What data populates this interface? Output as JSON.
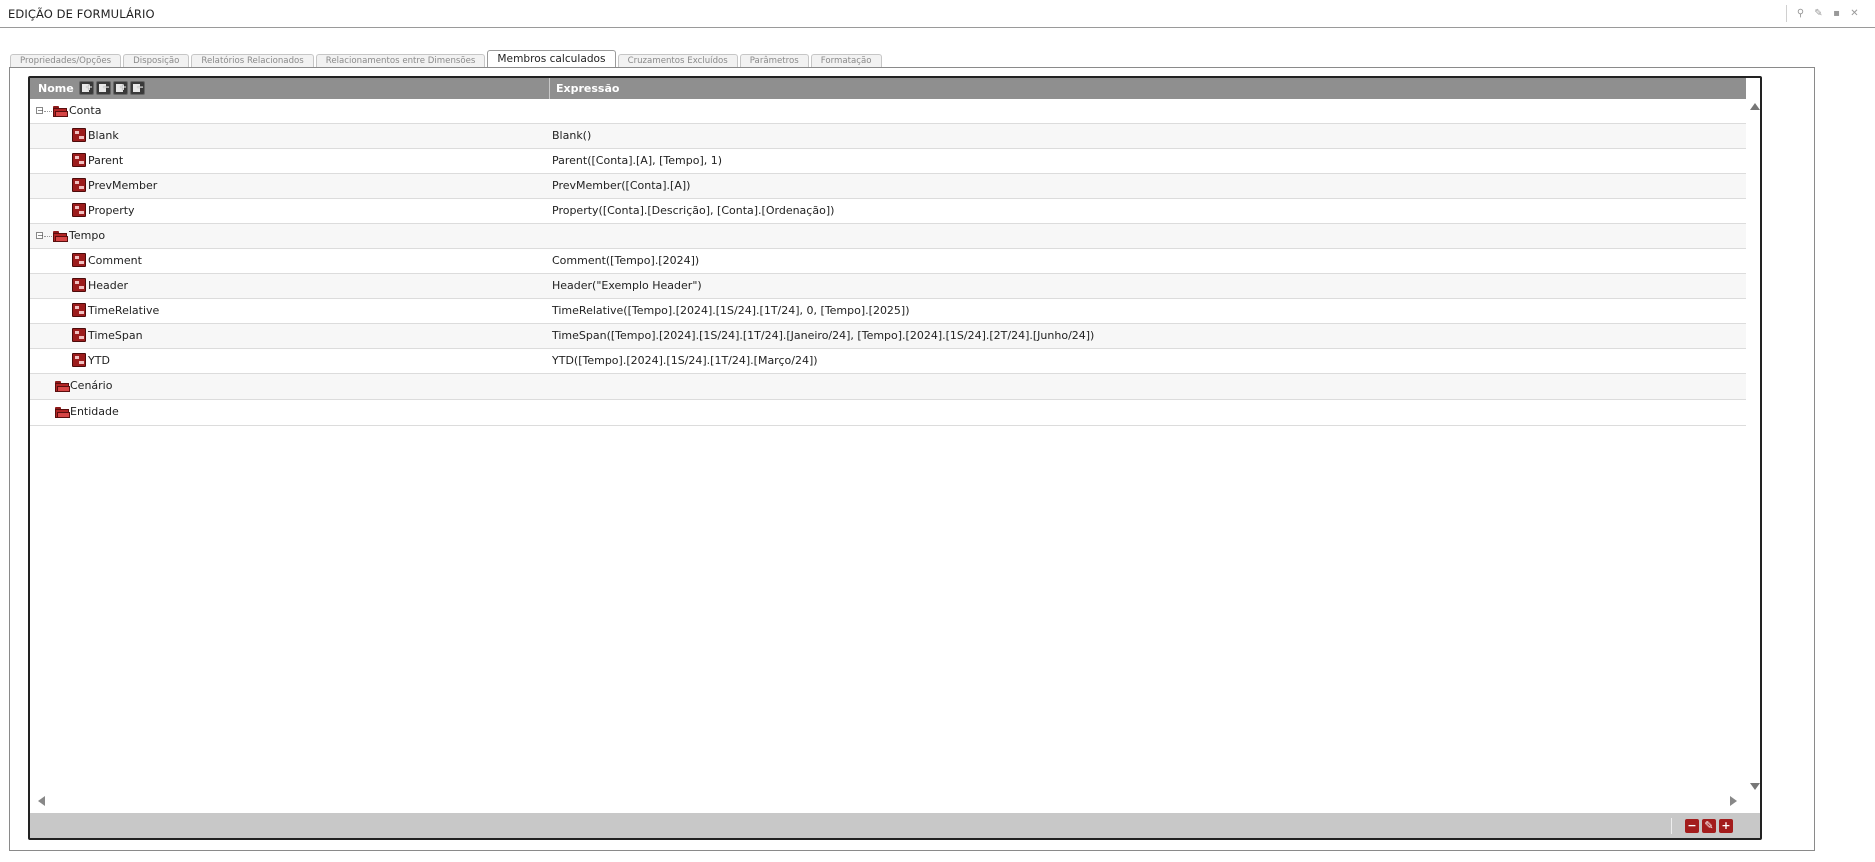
{
  "window": {
    "title": "EDIÇÃO DE FORMULÁRIO",
    "controls": [
      {
        "icon": "search-icon",
        "glyph": "⚲"
      },
      {
        "icon": "edit-icon",
        "glyph": "✎"
      },
      {
        "icon": "save-icon",
        "glyph": "▪"
      },
      {
        "icon": "close-icon",
        "glyph": "✕"
      }
    ]
  },
  "tabs": [
    {
      "label": "Propriedades/Opções",
      "active": false
    },
    {
      "label": "Disposição",
      "active": false
    },
    {
      "label": "Relatórios Relacionados",
      "active": false
    },
    {
      "label": "Relacionamentos entre Dimensões",
      "active": false
    },
    {
      "label": "Membros calculados",
      "active": true
    },
    {
      "label": "Cruzamentos Excluídos",
      "active": false
    },
    {
      "label": "Parâmetros",
      "active": false
    },
    {
      "label": "Formatação",
      "active": false
    }
  ],
  "grid": {
    "columns": {
      "name": "Nome",
      "expression": "Expressão"
    },
    "header_buttons": [
      {
        "icon": "add-icon",
        "badge": "+"
      },
      {
        "icon": "remove-icon",
        "badge": "−"
      },
      {
        "icon": "expand-icon",
        "badge": "+"
      },
      {
        "icon": "collapse-icon",
        "badge": "−"
      }
    ],
    "rows": [
      {
        "type": "group",
        "name": "Conta",
        "expanded": true,
        "expander": "−"
      },
      {
        "type": "member",
        "name": "Blank",
        "expression": "Blank()"
      },
      {
        "type": "member",
        "name": "Parent",
        "expression": "Parent([Conta].[A], [Tempo], 1)"
      },
      {
        "type": "member",
        "name": "PrevMember",
        "expression": "PrevMember([Conta].[A])"
      },
      {
        "type": "member",
        "name": "Property",
        "expression": "Property([Conta].[Descrição], [Conta].[Ordenação])"
      },
      {
        "type": "group",
        "name": "Tempo",
        "expanded": true,
        "expander": "−"
      },
      {
        "type": "member",
        "name": "Comment",
        "expression": "Comment([Tempo].[2024])"
      },
      {
        "type": "member",
        "name": "Header",
        "expression": "Header(\"Exemplo Header\")"
      },
      {
        "type": "member",
        "name": "TimeRelative",
        "expression": "TimeRelative([Tempo].[2024].[1S/24].[1T/24], 0, [Tempo].[2025])"
      },
      {
        "type": "member",
        "name": "TimeSpan",
        "expression": "TimeSpan([Tempo].[2024].[1S/24].[1T/24].[Janeiro/24], [Tempo].[2024].[1S/24].[2T/24].[Junho/24])"
      },
      {
        "type": "member",
        "name": "YTD",
        "expression": "YTD([Tempo].[2024].[1S/24].[1T/24].[Março/24])"
      },
      {
        "type": "group",
        "name": "Cenário",
        "expanded": false,
        "expander": ""
      },
      {
        "type": "group",
        "name": "Entidade",
        "expanded": false,
        "expander": ""
      }
    ]
  },
  "footer": {
    "buttons": [
      {
        "icon": "remove-icon",
        "glyph": "−"
      },
      {
        "icon": "edit-icon",
        "glyph": "✎"
      },
      {
        "icon": "add-icon",
        "glyph": "+"
      }
    ]
  }
}
